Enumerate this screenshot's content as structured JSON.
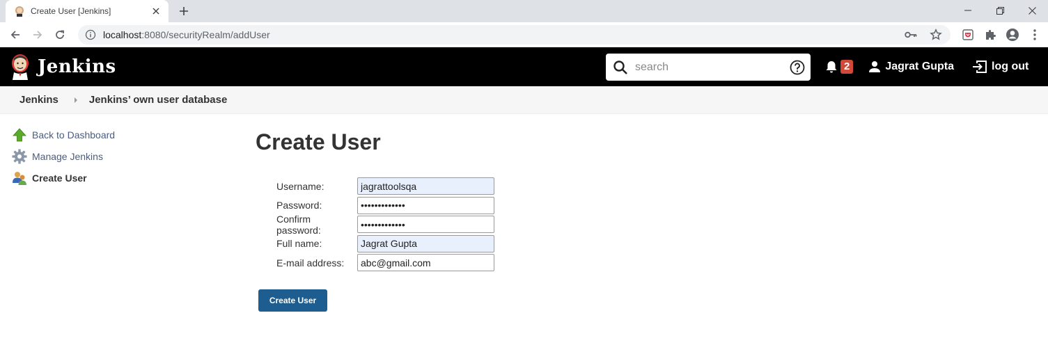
{
  "browser": {
    "tab_title": "Create User [Jenkins]",
    "url_host": "localhost",
    "url_rest": ":8080/securityRealm/addUser"
  },
  "header": {
    "logo_text": "Jenkins",
    "search_placeholder": "search",
    "notification_count": "2",
    "user_name": "Jagrat Gupta",
    "logout_label": "log out"
  },
  "breadcrumb": {
    "items": [
      "Jenkins",
      "Jenkins’ own user database"
    ]
  },
  "sidebar": {
    "items": [
      {
        "label": "Back to Dashboard",
        "icon": "up-arrow-icon"
      },
      {
        "label": "Manage Jenkins",
        "icon": "gear-icon"
      },
      {
        "label": "Create User",
        "icon": "users-icon"
      }
    ]
  },
  "main": {
    "title": "Create User",
    "form": {
      "username_label": "Username:",
      "username_value": "jagrattoolsqa",
      "password_label": "Password:",
      "password_value": "•••••••••••••",
      "confirm_label": "Confirm password:",
      "confirm_value": "•••••••••••••",
      "fullname_label": "Full name:",
      "fullname_value": "Jagrat Gupta",
      "email_label": "E-mail address:",
      "email_value": "abc@gmail.com"
    },
    "submit_label": "Create User"
  },
  "colors": {
    "header_bg": "#000000",
    "badge": "#d24939",
    "button": "#1d5d90",
    "autofill": "#e8f0fe"
  }
}
